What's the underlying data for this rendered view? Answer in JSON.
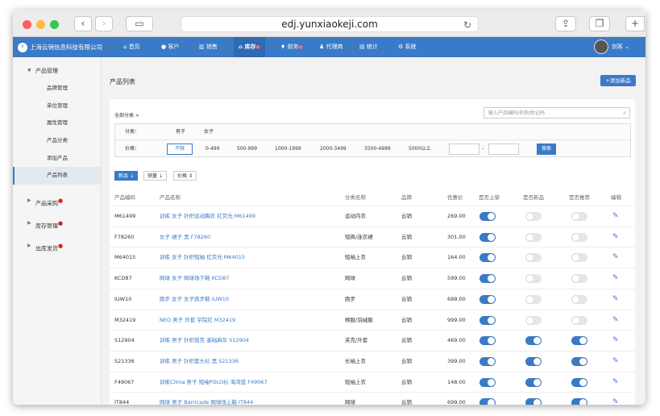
{
  "browser": {
    "url": "edj.yunxiaokeji.com"
  },
  "nav": {
    "brand": "上海云销信息科技有限公司",
    "items": [
      {
        "label": "首页",
        "icon": "home-icon",
        "sup": ""
      },
      {
        "label": "客户",
        "icon": "user-icon",
        "sup": ""
      },
      {
        "label": "销售",
        "icon": "chart-icon",
        "sup": ""
      },
      {
        "label": "库存",
        "icon": "warehouse-icon",
        "sup": "●"
      },
      {
        "label": "财务",
        "icon": "money-icon",
        "sup": "●"
      },
      {
        "label": "代理商",
        "icon": "group-icon",
        "sup": ""
      },
      {
        "label": "统计",
        "icon": "stats-icon",
        "sup": ""
      },
      {
        "label": "系统",
        "icon": "gear-icon",
        "sup": ""
      }
    ],
    "user_name": "剑客"
  },
  "sidebar": {
    "group1": "产品管理",
    "items": [
      "品牌管理",
      "单位管理",
      "属性管理",
      "产品分类",
      "添加产品",
      "产品列表"
    ],
    "groups": [
      {
        "label": "产品采购",
        "dot": "●"
      },
      {
        "label": "库存管理",
        "dot": "●"
      },
      {
        "label": "出库发货",
        "dot": "●"
      }
    ]
  },
  "page": {
    "title": "产品列表",
    "add_button": "添加新品",
    "breadcrumb": "全部分类  >",
    "search_placeholder": "输入产品编码/名称/助记码"
  },
  "filter": {
    "category_label": "分类：",
    "categories": [
      "男子",
      "女子"
    ],
    "price_label": "价格：",
    "prices": [
      "不限",
      "0-499",
      "500-999",
      "1000-1999",
      "2000-3499",
      "3500-4999",
      "5000以上"
    ],
    "range_sep": "-",
    "search_button": "搜索"
  },
  "sort": {
    "new": "新品",
    "sales": "销量",
    "price": "价格"
  },
  "table": {
    "headers": [
      "产品编码",
      "产品名称",
      "分类名称",
      "品牌",
      "优惠价",
      "是否上架",
      "是否新品",
      "是否推荐",
      "编辑"
    ],
    "rows": [
      {
        "code": "M61499",
        "name": "训练 女子 针织运动胸衣 红荧光 M61499",
        "category": "运动内衣",
        "brand": "云销",
        "price": "269.00",
        "listed": true,
        "new": false,
        "rec": false
      },
      {
        "code": "F78260",
        "name": "女子 裙子 黑 F78260",
        "category": "短裤/连衣裙",
        "brand": "云销",
        "price": "301.00",
        "listed": true,
        "new": false,
        "rec": false
      },
      {
        "code": "M64015",
        "name": "训练 女子 针织短袖 红荧光 M64015",
        "category": "短袖上衣",
        "brand": "云销",
        "price": "164.00",
        "listed": true,
        "new": false,
        "rec": false
      },
      {
        "code": "KCD87",
        "name": "网球 女子 网球场下鞋 KCD87",
        "category": "网球",
        "brand": "云销",
        "price": "599.00",
        "listed": true,
        "new": false,
        "rec": false
      },
      {
        "code": "IUW10",
        "name": "跑步 女子 女子跑步鞋 IUW10",
        "category": "跑步",
        "brand": "云销",
        "price": "699.00",
        "listed": true,
        "new": false,
        "rec": false
      },
      {
        "code": "M32419",
        "name": "NEO 男子 外套 学院红 M32419",
        "category": "棉服/羽绒服",
        "brand": "云销",
        "price": "999.00",
        "listed": true,
        "new": false,
        "rec": false
      },
      {
        "code": "S12904",
        "name": "训练 男子 针织茄克 基础麻灰 S12904",
        "category": "夹克/外套",
        "brand": "云销",
        "price": "469.00",
        "listed": true,
        "new": true,
        "rec": true
      },
      {
        "code": "S21336",
        "name": "训练 男子 针织套头衫 黑 S21336",
        "category": "长袖上衣",
        "brand": "云销",
        "price": "399.00",
        "listed": true,
        "new": true,
        "rec": true
      },
      {
        "code": "F49067",
        "name": "训练Clima 男子 短袖POLO衫 海湾蓝 F49067",
        "category": "短袖上衣",
        "brand": "云销",
        "price": "148.00",
        "listed": true,
        "new": true,
        "rec": true
      },
      {
        "code": "IT844",
        "name": "网球 男子 Barricade 网球场上鞋 IT844",
        "category": "网球",
        "brand": "云销",
        "price": "699.00",
        "listed": true,
        "new": true,
        "rec": true
      }
    ]
  },
  "colors": {
    "accent": "#3a7ac6"
  }
}
